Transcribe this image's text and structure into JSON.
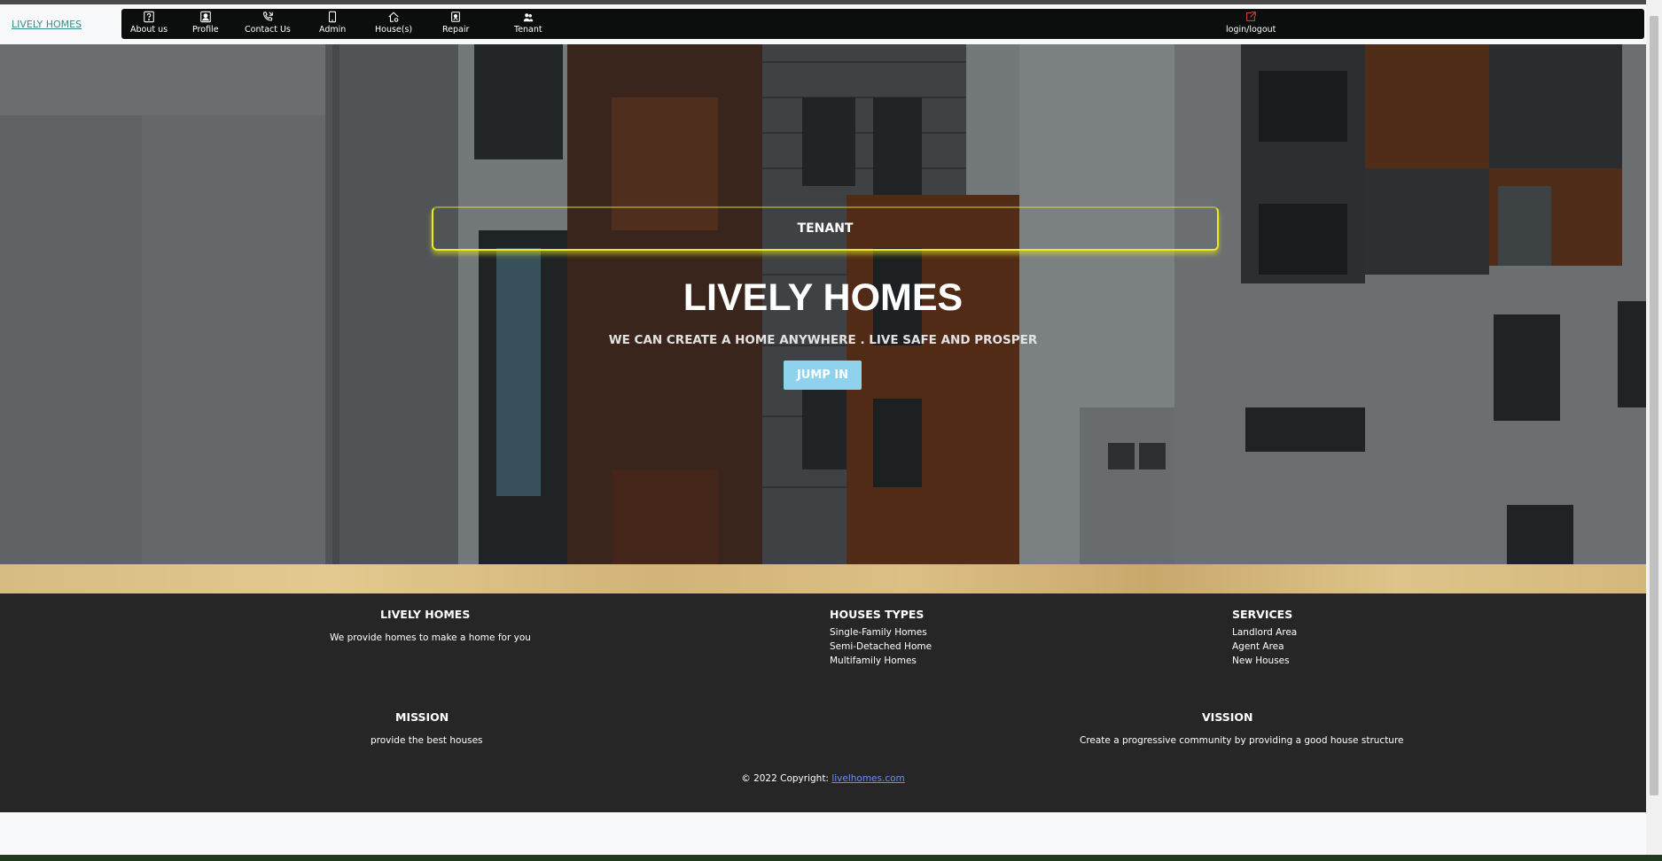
{
  "brand": "LIVELY HOMES",
  "nav": {
    "items": [
      {
        "label": "About us",
        "icon": "question-square-icon"
      },
      {
        "label": "Profile",
        "icon": "person-square-icon"
      },
      {
        "label": "Contact Us",
        "icon": "phone-icon"
      },
      {
        "label": "Admin",
        "icon": "tablet-icon"
      },
      {
        "label": "House(s)",
        "icon": "house-gear-icon"
      },
      {
        "label": "Repair",
        "icon": "person-badge-icon"
      },
      {
        "label": "Tenant",
        "icon": "people-icon"
      }
    ],
    "logout": {
      "label": "login/logout",
      "icon": "box-arrow-up-right-icon"
    }
  },
  "hero": {
    "badge": "TENANT",
    "title": "LIVELY HOMES",
    "subtitle": "WE CAN CREATE A HOME ANYWHERE . LIVE SAFE AND PROSPER",
    "button": "JUMP IN"
  },
  "footer": {
    "about": {
      "heading": "LIVELY HOMES",
      "text": "We provide homes to make a home for you"
    },
    "house_types": {
      "heading": "HOUSES TYPES",
      "items": [
        "Single-Family Homes",
        "Semi-Detached Home",
        "Multifamily Homes"
      ]
    },
    "services": {
      "heading": "SERVICES",
      "items": [
        "Landlord Area",
        "Agent Area",
        "New Houses"
      ]
    },
    "mission": {
      "heading": "MISSION",
      "text": "provide the best houses"
    },
    "vision": {
      "heading": "VISSION",
      "text": "Create a progressive community by providing a good house structure"
    },
    "copyright": {
      "text": "© 2022 Copyright: ",
      "link": "livelhomes.com"
    }
  },
  "colors": {
    "accent_border": "#e8ea22",
    "button": "#8fd2ee",
    "footer_bg": "#262626",
    "link": "#6b8cff"
  }
}
